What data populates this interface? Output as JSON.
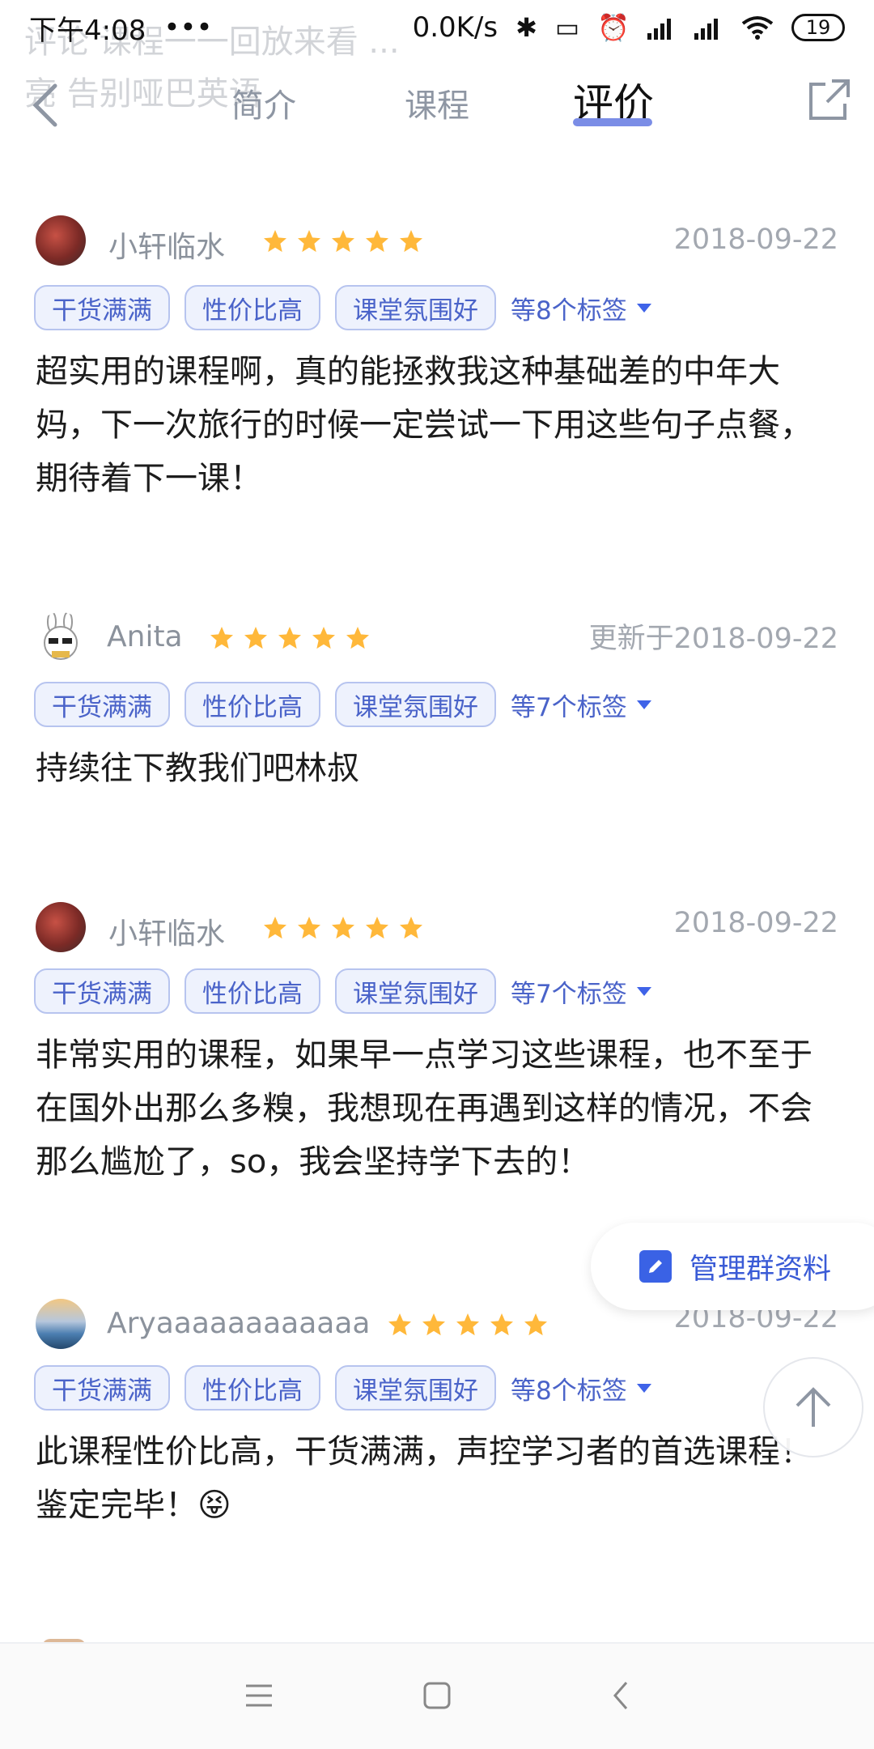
{
  "status_bar": {
    "time": "下午4:08",
    "dots": "•••",
    "speed": "0.0K/s",
    "battery": "19"
  },
  "ghost_text": {
    "line1": "评论 课程一一回放来看 ...",
    "line2": "亮 告别哑巴英语"
  },
  "header": {
    "tabs": [
      "简介",
      "课程",
      "评价"
    ],
    "active_tab": "评价"
  },
  "reviews": [
    {
      "username": "小轩临水",
      "date": "2018-09-22",
      "rating": 5,
      "tags": [
        "干货满满",
        "性价比高",
        "课堂氛围好"
      ],
      "more_tags": "等8个标签",
      "content": "超实用的课程啊，真的能拯救我这种基础差的中年大妈，下一次旅行的时候一定尝试一下用这些句子点餐，期待着下一课！"
    },
    {
      "username": "Anita",
      "date": "更新于2018-09-22",
      "rating": 5,
      "tags": [
        "干货满满",
        "性价比高",
        "课堂氛围好"
      ],
      "more_tags": "等7个标签",
      "content": "持续往下教我们吧林叔"
    },
    {
      "username": "小轩临水",
      "date": "2018-09-22",
      "rating": 5,
      "tags": [
        "干货满满",
        "性价比高",
        "课堂氛围好"
      ],
      "more_tags": "等7个标签",
      "content": "非常实用的课程，如果早一点学习这些课程，也不至于在国外出那么多糗，我想现在再遇到这样的情况，不会那么尴尬了，so，我会坚持学下去的！"
    },
    {
      "username": "Aryaaaaaaaaaaaa",
      "date": "2018-09-22",
      "rating": 5,
      "tags": [
        "干货满满",
        "性价比高",
        "课堂氛围好"
      ],
      "more_tags": "等8个标签",
      "content": "此课程性价比高，干货满满，声控学习者的首选课程！鉴定完毕！😝"
    }
  ],
  "floating": {
    "manage_label": "管理群资料"
  },
  "colors": {
    "accent": "#3a5bd6",
    "tag_bg": "#eef2fd",
    "star": "#ffb83a",
    "tab_underline": "#7b8de6"
  }
}
